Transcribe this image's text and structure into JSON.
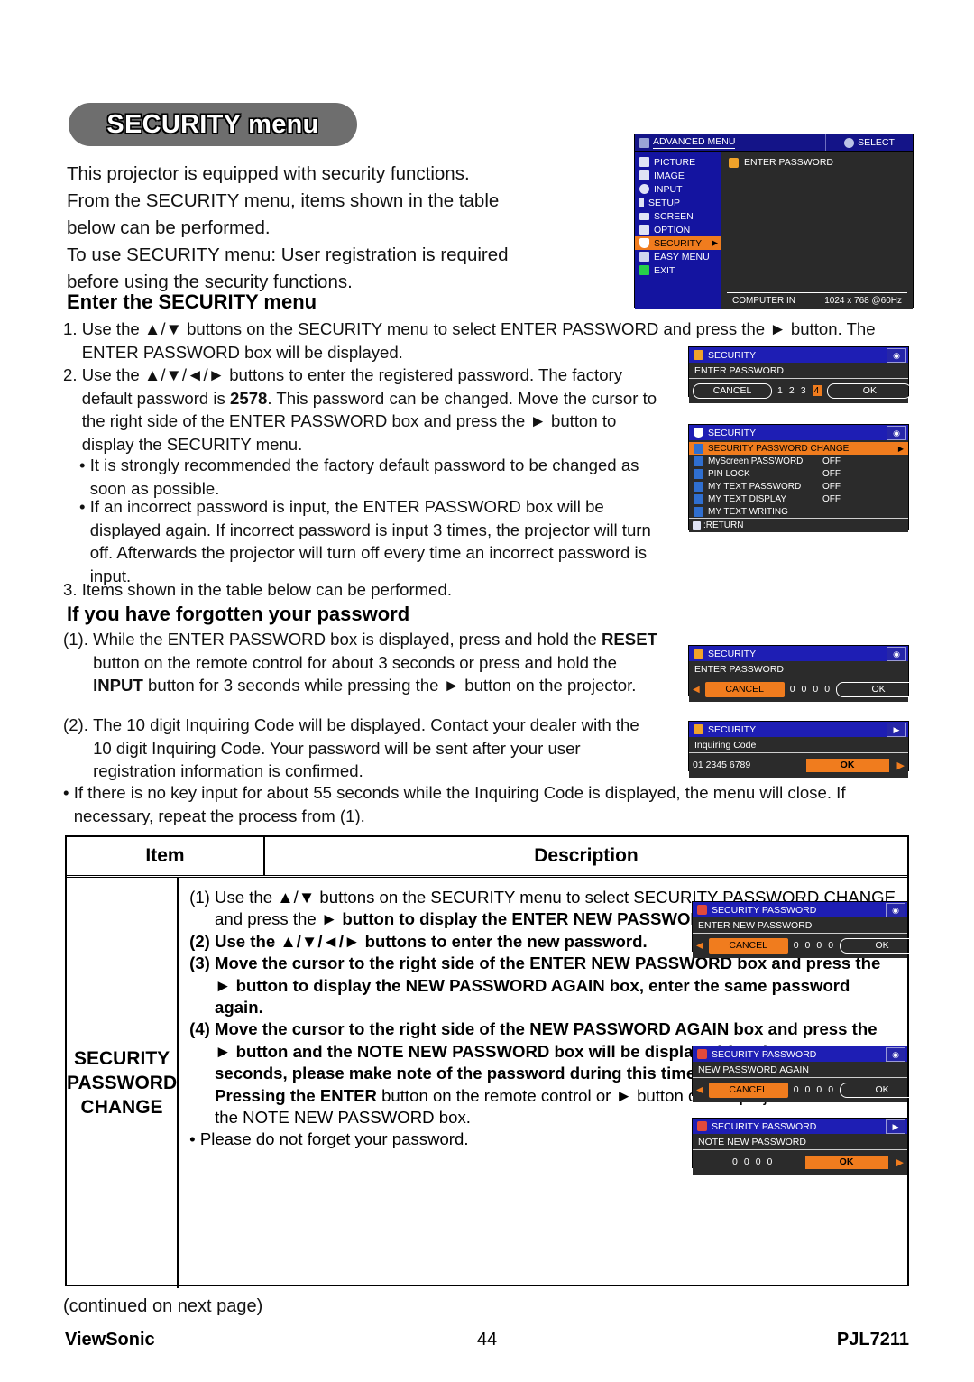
{
  "page": {
    "title": "SECURITY menu",
    "continued": "(continued on next page)",
    "footer": {
      "brand": "ViewSonic",
      "page_number": "44",
      "model": "PJL7211"
    },
    "colors": {
      "accent_orange": "#f07c1e",
      "osd_blue": "#1212a8",
      "osd_panel": "#2b2b2b",
      "title_pill": "#6e6e6e"
    }
  },
  "intro": {
    "line1": "This projector is equipped with security functions.",
    "line2": "From the SECURITY menu, items shown in the table",
    "line3": "below can be performed.",
    "line4": "To use SECURITY menu: User registration is required",
    "line5": "before using the security functions."
  },
  "enter_section": {
    "heading": "Enter the SECURITY menu",
    "step1_num": "1. ",
    "step1_text": "Use the ▲/▼ buttons on the SECURITY menu to select ENTER PASSWORD and press the ► button. The ENTER PASSWORD box will be displayed.",
    "step2_num": "2. ",
    "step2_a": "Use the ▲/▼/◄/► buttons to enter the registered password. The factory default password is ",
    "step2_bold": "2578",
    "step2_b": ". This password can be changed. Move the cursor to the right side of the ENTER PASSWORD box and press the ► button to display the SECURITY menu.",
    "note1_dot": "• ",
    "note1_text": "It is strongly recommended the factory default password to be changed as soon as possible.",
    "note2_dot": "• ",
    "note2_text": "If an incorrect password is input, the ENTER PASSWORD box will be displayed again. If incorrect password is input 3 times, the projector will turn off. Afterwards the projector will turn off every time an incorrect password is input.",
    "step3_num": "3. ",
    "step3_text": "Items shown in the table below can be performed."
  },
  "forgotten_section": {
    "heading": "If you have forgotten your password",
    "f1_num": "(1). ",
    "f1_a": "While the ENTER PASSWORD box is displayed, press and hold the ",
    "f1_bold1": "RESET",
    "f1_b": " button on the remote control for about 3 seconds or press and hold the ",
    "f1_bold2": "INPUT",
    "f1_c": " button for 3 seconds while pressing the ► button on the projector.",
    "f2_num": "(2). ",
    "f2_text": "The 10 digit Inquiring Code will be displayed. Contact your dealer with the 10 digit Inquiring Code. Your password will be sent after your user registration information is confirmed.",
    "fnote_dot": "• ",
    "fnote_text": "If there is no key input for about 55 seconds while the Inquiring Code is displayed, the menu will close. If necessary, repeat the process from (1)."
  },
  "table": {
    "headers": {
      "item": "Item",
      "description": "Description"
    },
    "row": {
      "item": "SECURITY\nPASSWORD\nCHANGE",
      "item_line1": "SECURITY",
      "item_line2": "PASSWORD",
      "item_line3": "CHANGE",
      "d1_num": "(1) ",
      "d1_plain": "Use the ▲/▼ buttons on the SECURITY menu to select SECURITY PASSWORD CHANGE and press the ► ",
      "d1_bold": "button to display the ENTER NEW PASSWORD box.",
      "d2_num": "(2) ",
      "d2_bold": "Use the ▲/▼/◄/► buttons to enter the new password.",
      "d3_num": "(3) ",
      "d3_bold": "Move the cursor to the right side of the ENTER NEW PASSWORD box and press the ► button to display the NEW PASSWORD AGAIN box, enter the same password again.",
      "d4_num": "(4) ",
      "d4_bold": "Move the cursor to the right side of the NEW PASSWORD AGAIN box and press the ► button and the NOTE NEW PASSWORD box will be displayed for about 30 seconds, please make note of the password during this time.",
      "d5_bold": "Pressing the ENTER",
      "d5_plain": " button on the remote control or ► button on the projector will close the NOTE NEW PASSWORD box.",
      "d6_dot": "• ",
      "d6_text": "Please do not forget your password."
    }
  },
  "osd_advanced": {
    "title": "ADVANCED MENU",
    "select_label": "SELECT",
    "menu_items": [
      {
        "label": "PICTURE",
        "selected": false
      },
      {
        "label": "IMAGE",
        "selected": false
      },
      {
        "label": "INPUT",
        "selected": false
      },
      {
        "label": "SETUP",
        "selected": false
      },
      {
        "label": "SCREEN",
        "selected": false
      },
      {
        "label": "OPTION",
        "selected": false
      },
      {
        "label": "SECURITY",
        "selected": true
      },
      {
        "label": "EASY MENU",
        "selected": false
      },
      {
        "label": "EXIT",
        "selected": false
      }
    ],
    "content_item": "ENTER PASSWORD",
    "status_source": "COMPUTER IN",
    "status_mode": "1024 x 768 @60Hz"
  },
  "osd_enter_password_1": {
    "title": "SECURITY",
    "field": "ENTER PASSWORD",
    "cancel": "CANCEL",
    "digits": [
      "1",
      "2",
      "3",
      "4"
    ],
    "selected_digit_index": 3,
    "ok": "OK",
    "cancel_highlighted": false,
    "ok_highlighted": false
  },
  "osd_security_menu": {
    "title": "SECURITY",
    "items": [
      {
        "label": "SECURITY PASSWORD CHANGE",
        "value": "",
        "selected": true
      },
      {
        "label": "MyScreen PASSWORD",
        "value": "OFF",
        "selected": false
      },
      {
        "label": "PIN LOCK",
        "value": "OFF",
        "selected": false
      },
      {
        "label": "MY TEXT PASSWORD",
        "value": "OFF",
        "selected": false
      },
      {
        "label": "MY TEXT DISPLAY",
        "value": "OFF",
        "selected": false
      },
      {
        "label": "MY TEXT WRITING",
        "value": "",
        "selected": false
      }
    ],
    "return_label": ":RETURN"
  },
  "osd_enter_password_2": {
    "title": "SECURITY",
    "field": "ENTER PASSWORD",
    "cancel": "CANCEL",
    "digits": [
      "0",
      "0",
      "0",
      "0"
    ],
    "ok": "OK",
    "cancel_highlighted": true,
    "ok_highlighted": false
  },
  "osd_inquiring": {
    "title": "SECURITY",
    "field": "Inquiring Code",
    "code": "01 2345 6789",
    "ok": "OK",
    "ok_highlighted": true
  },
  "osd_enter_new_password": {
    "title": "SECURITY PASSWORD",
    "field": "ENTER NEW PASSWORD",
    "cancel": "CANCEL",
    "digits": [
      "0",
      "0",
      "0",
      "0"
    ],
    "ok": "OK",
    "cancel_highlighted": true,
    "ok_highlighted": false
  },
  "osd_new_password_again": {
    "title": "SECURITY PASSWORD",
    "field": "NEW PASSWORD AGAIN",
    "cancel": "CANCEL",
    "digits": [
      "0",
      "0",
      "0",
      "0"
    ],
    "ok": "OK",
    "cancel_highlighted": true,
    "ok_highlighted": false
  },
  "osd_note_new_password": {
    "title": "SECURITY PASSWORD",
    "field": "NOTE NEW PASSWORD",
    "digits": [
      "0",
      "0",
      "0",
      "0"
    ],
    "ok": "OK",
    "ok_highlighted": true
  }
}
